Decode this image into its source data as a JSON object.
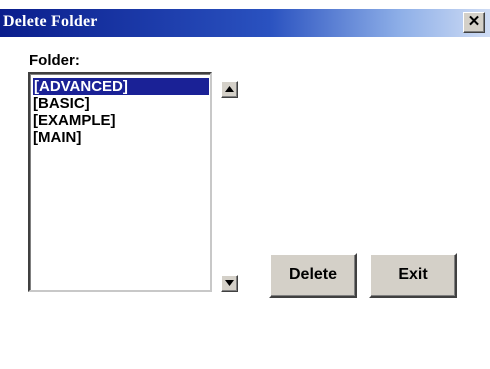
{
  "window": {
    "title": "Delete Folder",
    "close_glyph": "✕"
  },
  "folder_list": {
    "label": "Folder:",
    "selected_index": 0,
    "items": [
      {
        "label": "[ADVANCED]"
      },
      {
        "label": "[BASIC]"
      },
      {
        "label": "[EXAMPLE]"
      },
      {
        "label": "[MAIN]"
      }
    ]
  },
  "buttons": {
    "delete_label": "Delete",
    "exit_label": "Exit"
  },
  "icons": {
    "close": "close-icon",
    "scroll_up": "arrow-up-icon",
    "scroll_down": "arrow-down-icon"
  },
  "colors": {
    "titlebar_start": "#0a1d8c",
    "selection": "#1a2196",
    "button_face": "#d4d0c8"
  }
}
